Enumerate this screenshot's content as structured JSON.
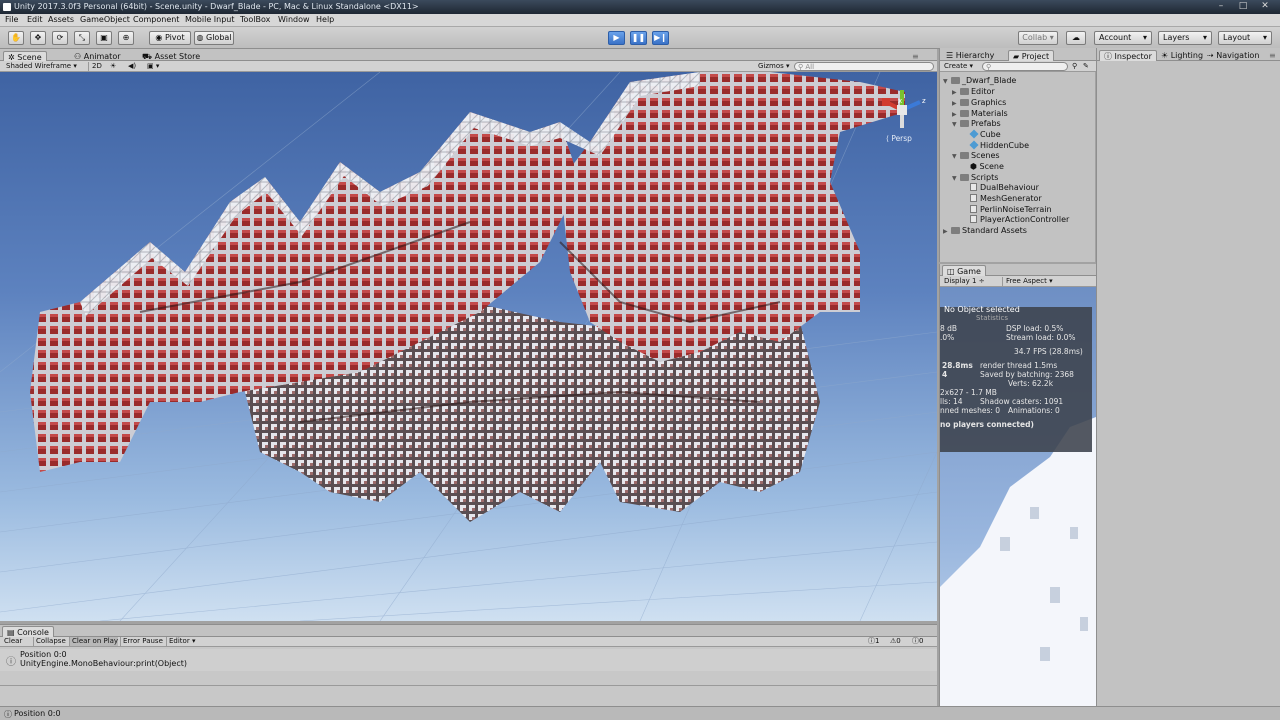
{
  "window": {
    "title": "Unity 2017.3.0f3 Personal (64bit) - Scene.unity - Dwarf_Blade - PC, Mac & Linux Standalone <DX11>",
    "controls": [
      "–",
      "□",
      "✕"
    ]
  },
  "menu": [
    "File",
    "Edit",
    "Assets",
    "GameObject",
    "Component",
    "Mobile Input",
    "ToolBox",
    "Window",
    "Help"
  ],
  "toolbar": {
    "pivot": "Pivot",
    "global": "Global",
    "collab": "Collab ▾",
    "account": "Account",
    "layers": "Layers",
    "layout": "Layout"
  },
  "scene_tabs": [
    "Scene",
    "Animator",
    "Asset Store"
  ],
  "scene_bar": {
    "shading": "Shaded Wireframe",
    "mode2d": "2D",
    "gizmos": "Gizmos",
    "search_placeholder": "All"
  },
  "gizmo": {
    "x": "x",
    "z": "z",
    "persp": "Persp"
  },
  "right_tabs": [
    "Hierarchy",
    "Project"
  ],
  "project": {
    "create": "Create",
    "tree": [
      {
        "label": "_Dwarf_Blade",
        "kind": "folder",
        "level": 0,
        "open": true
      },
      {
        "label": "Editor",
        "kind": "folder",
        "level": 1,
        "open": false
      },
      {
        "label": "Graphics",
        "kind": "folder",
        "level": 1,
        "open": false
      },
      {
        "label": "Materials",
        "kind": "folder",
        "level": 1,
        "open": false
      },
      {
        "label": "Prefabs",
        "kind": "folder",
        "level": 1,
        "open": true
      },
      {
        "label": "Cube",
        "kind": "prefab",
        "level": 2
      },
      {
        "label": "HiddenCube",
        "kind": "prefab",
        "level": 2
      },
      {
        "label": "Scenes",
        "kind": "folder",
        "level": 1,
        "open": true
      },
      {
        "label": "Scene",
        "kind": "scene",
        "level": 2
      },
      {
        "label": "Scripts",
        "kind": "folder",
        "level": 1,
        "open": true
      },
      {
        "label": "DualBehaviour",
        "kind": "script",
        "level": 2
      },
      {
        "label": "MeshGenerator",
        "kind": "script",
        "level": 2
      },
      {
        "label": "PerlinNoiseTerrain",
        "kind": "script",
        "level": 2
      },
      {
        "label": "PlayerActionController",
        "kind": "script",
        "level": 2
      },
      {
        "label": "Standard Assets",
        "kind": "folder",
        "level": 0,
        "open": false
      }
    ]
  },
  "game": {
    "tab": "Game",
    "display": "Display 1",
    "aspect": "Free Aspect",
    "no_object": "No Object selected",
    "stats_title": "Statistics",
    "stats": {
      "audio_db": "8 dB",
      "dsp": "DSP load: 0.5%",
      "level": ".0%",
      "stream": "Stream load: 0.0%",
      "fps": "34.7 FPS (28.8ms)",
      "cpu": "28.8ms",
      "render_thread": "render thread 1.5ms",
      "batches": "4",
      "saved": "Saved by batching: 2368",
      "verts": "Verts: 62.2k",
      "res": "2x627 - 1.7 MB",
      "setpass": "lls: 14",
      "shadow": "Shadow casters: 1091",
      "skinned": "nned meshes: 0",
      "anim": "Animations: 0",
      "network": "no players connected)"
    }
  },
  "inspector_tabs": [
    "Inspector",
    "Lighting",
    "Navigation"
  ],
  "console": {
    "tab": "Console",
    "buttons": [
      "Clear",
      "Collapse",
      "Clear on Play",
      "Error Pause",
      "Editor ▾"
    ],
    "counts": [
      "1",
      "0",
      "0"
    ],
    "entry_line1": "Position 0:0",
    "entry_line2": "UnityEngine.MonoBehaviour:print(Object)"
  },
  "status": "Position 0:0",
  "colors": {
    "sky_top": "#3f63a3",
    "terrain_red": "#8e2a2a",
    "terrain_white": "#d9d9df",
    "play_blue": "#3a72c7"
  }
}
